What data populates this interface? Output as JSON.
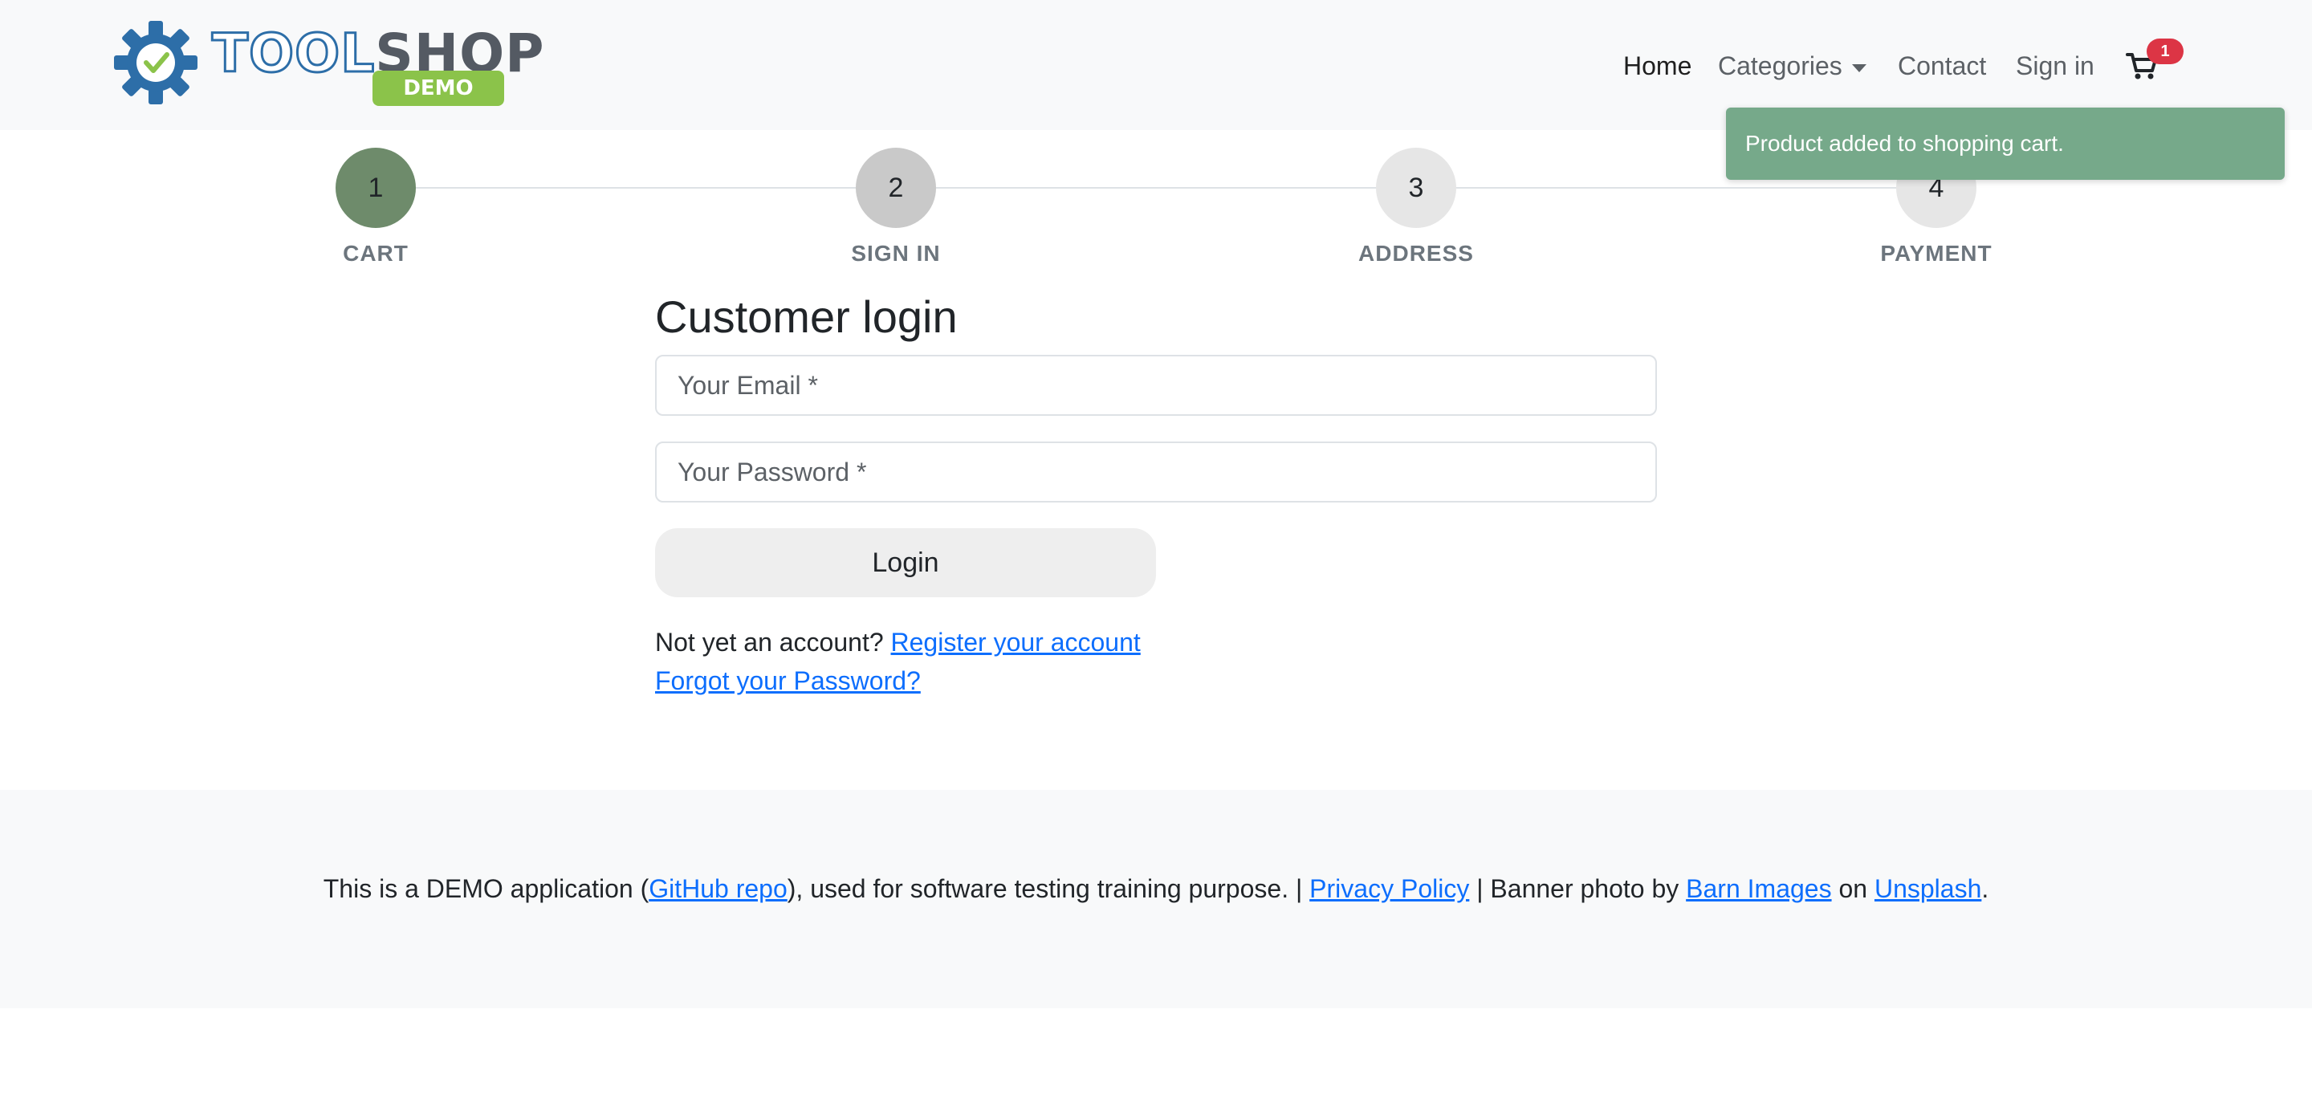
{
  "logo": {
    "part1": "TOOL",
    "part2": "SHOP",
    "badge": "DEMO"
  },
  "nav": {
    "home": "Home",
    "categories": "Categories",
    "contact": "Contact",
    "sign_in": "Sign in",
    "cart_count": "1"
  },
  "toast": {
    "message": "Product added to shopping cart."
  },
  "steps": [
    {
      "number": "1",
      "label": "CART"
    },
    {
      "number": "2",
      "label": "SIGN IN"
    },
    {
      "number": "3",
      "label": "ADDRESS"
    },
    {
      "number": "4",
      "label": "PAYMENT"
    }
  ],
  "login": {
    "title": "Customer login",
    "email_placeholder": "Your Email *",
    "password_placeholder": "Your Password *",
    "button": "Login",
    "no_account_text": "Not yet an account?",
    "register_link": "Register your account",
    "forgot_link": "Forgot your Password?"
  },
  "footer": {
    "text1": "This is a DEMO application (",
    "github_link": "GitHub repo",
    "text2": "), used for software testing training purpose. | ",
    "privacy_link": "Privacy Policy",
    "text3": " | Banner photo by ",
    "barn_link": "Barn Images",
    "text4": " on ",
    "unsplash_link": "Unsplash",
    "text5": "."
  },
  "colors": {
    "step_active": "#6e8b6b",
    "step_2": "#c9c9c9",
    "step_inactive": "#e6e6e6",
    "toast_bg": "#76a98a",
    "badge": "#dc3545",
    "link": "#0d6efd",
    "logo_blue": "#2d6ea8",
    "logo_green": "#8bc34a"
  }
}
